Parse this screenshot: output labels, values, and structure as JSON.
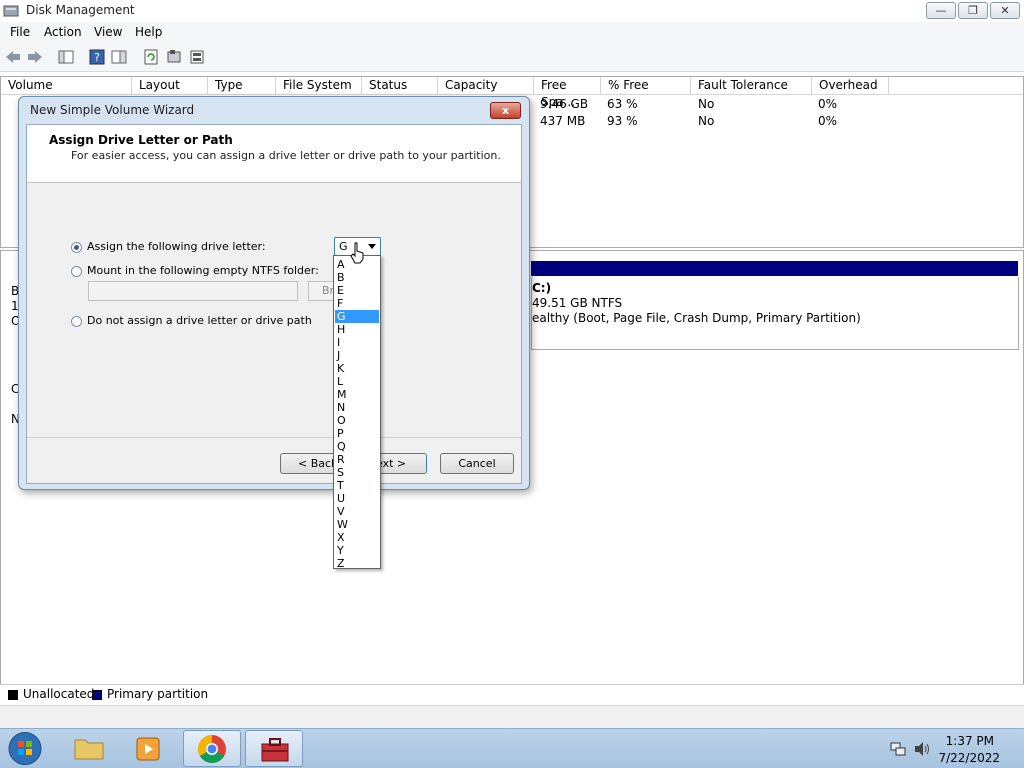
{
  "window": {
    "title": "Disk Management"
  },
  "menu": [
    "File",
    "Action",
    "View",
    "Help"
  ],
  "columns": [
    "Volume",
    "Layout",
    "Type",
    "File System",
    "Status",
    "Capacity",
    "Free Spa...",
    "% Free",
    "Fault Tolerance",
    "Overhead"
  ],
  "rows": [
    {
      "free_space": "9.46 GB",
      "pct_free": "63 %",
      "fault_tolerance": "No",
      "overhead": "0%"
    },
    {
      "free_space": "437 MB",
      "pct_free": "93 %",
      "fault_tolerance": "No",
      "overhead": "0%"
    }
  ],
  "partition": {
    "line1": "C:)",
    "line2": "49.51 GB NTFS",
    "line3": "ealthy (Boot, Page File, Crash Dump, Primary Partition)"
  },
  "disk_labels_left": [
    "B",
    "1",
    "O",
    "C",
    "N"
  ],
  "legend": {
    "unallocated": "Unallocated",
    "primary": "Primary partition"
  },
  "wizard": {
    "title": "New Simple Volume Wizard",
    "close": "x",
    "heading": "Assign Drive Letter or Path",
    "subheading": "For easier access, you can assign a drive letter or drive path to your partition.",
    "option_letter": "Assign the following drive letter:",
    "option_folder": "Mount in the following empty NTFS folder:",
    "option_none": "Do not assign a drive letter or drive path",
    "selected_letter": "G",
    "browse_label": "Br",
    "back_label": "< Back",
    "next_label": "ext >",
    "cancel_label": "Cancel"
  },
  "drive_letters": [
    "A",
    "B",
    "E",
    "F",
    "G",
    "H",
    "I",
    "J",
    "K",
    "L",
    "M",
    "N",
    "O",
    "P",
    "Q",
    "R",
    "S",
    "T",
    "U",
    "V",
    "W",
    "X",
    "Y",
    "Z"
  ],
  "selected_index": 4,
  "clock": {
    "time": "1:37 PM",
    "date": "7/22/2022"
  },
  "colors": {
    "primary_partition": "#00007f",
    "selection": "#3399ff"
  }
}
